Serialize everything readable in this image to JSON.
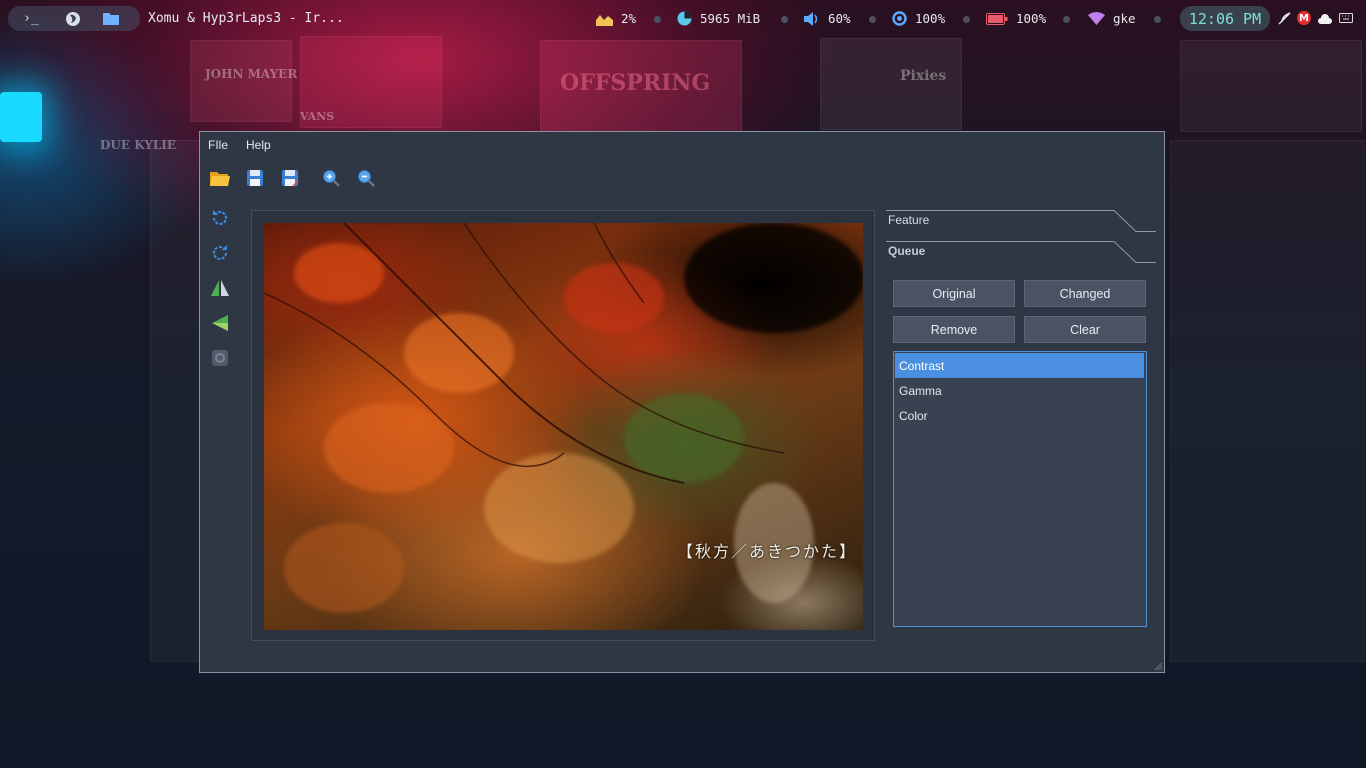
{
  "topbar": {
    "terminal_icon_glyph": "›_",
    "window_title": "Xomu & Hyp3rLaps3 - Ir...",
    "cpu": "2%",
    "memory": "5965 MiB",
    "volume": "60%",
    "brightness": "100%",
    "battery": "100%",
    "network": "gke",
    "clock": "12:06 PM",
    "accent_colors": {
      "cpu": "#f1c15a",
      "memory": "#5ac8e8",
      "volume": "#5aa8ff",
      "brightness": "#5aa8ff",
      "battery": "#e85a6a",
      "wifi": "#c27ef0"
    }
  },
  "wallpaper_text": {
    "john_mayer": "JOHN MAYER",
    "vans": "VANS",
    "offspring": "OFFSPRING",
    "pixies": "Pixies",
    "kylie": "DUE KYLIE"
  },
  "menu": {
    "file": "FIle",
    "help": "Help"
  },
  "toolbar": [
    "open-folder-icon",
    "save-icon",
    "save-as-icon",
    "zoom-in-icon",
    "zoom-out-icon"
  ],
  "sidetools": [
    "rotate-left-icon",
    "rotate-right-icon",
    "flip-horizontal-icon",
    "flip-vertical-icon",
    "reset-icon"
  ],
  "image": {
    "caption": "【秋方／あきつかた】"
  },
  "panel": {
    "tab_feature": "Feature",
    "tab_queue": "Queue",
    "buttons": {
      "original": "Original",
      "changed": "Changed",
      "remove": "Remove",
      "clear": "Clear"
    },
    "queue": [
      {
        "label": "Contrast",
        "selected": true
      },
      {
        "label": "Gamma",
        "selected": false
      },
      {
        "label": "Color",
        "selected": false
      }
    ]
  }
}
